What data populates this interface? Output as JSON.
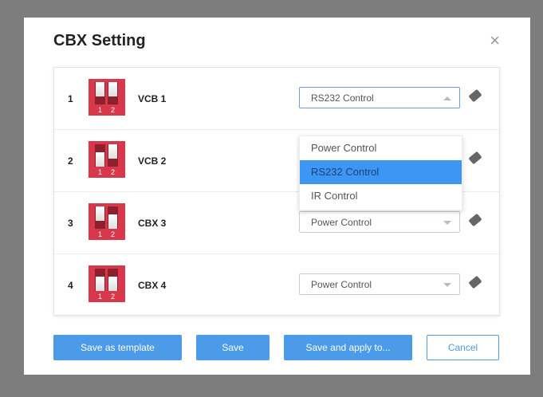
{
  "dialog": {
    "title": "CBX Setting",
    "close_icon": "×"
  },
  "rows": [
    {
      "num": "1",
      "name": "VCB 1",
      "switches": [
        "up",
        "up"
      ],
      "value": "RS232 Control",
      "open": true
    },
    {
      "num": "2",
      "name": "VCB 2",
      "switches": [
        "down",
        "up"
      ],
      "value": "",
      "open": false
    },
    {
      "num": "3",
      "name": "CBX 3",
      "switches": [
        "up",
        "down"
      ],
      "value": "Power Control",
      "open": false
    },
    {
      "num": "4",
      "name": "CBX 4",
      "switches": [
        "down",
        "down"
      ],
      "value": "Power Control",
      "open": false
    }
  ],
  "dip_labels": [
    "1",
    "2"
  ],
  "dropdown": {
    "options": [
      "Power Control",
      "RS232 Control",
      "IR Control"
    ],
    "selected": "RS232 Control"
  },
  "buttons": {
    "save_template": "Save as template",
    "save": "Save",
    "save_apply": "Save and apply to...",
    "cancel": "Cancel"
  },
  "colors": {
    "primary": "#4b9be9",
    "dip": "#d9374b"
  }
}
